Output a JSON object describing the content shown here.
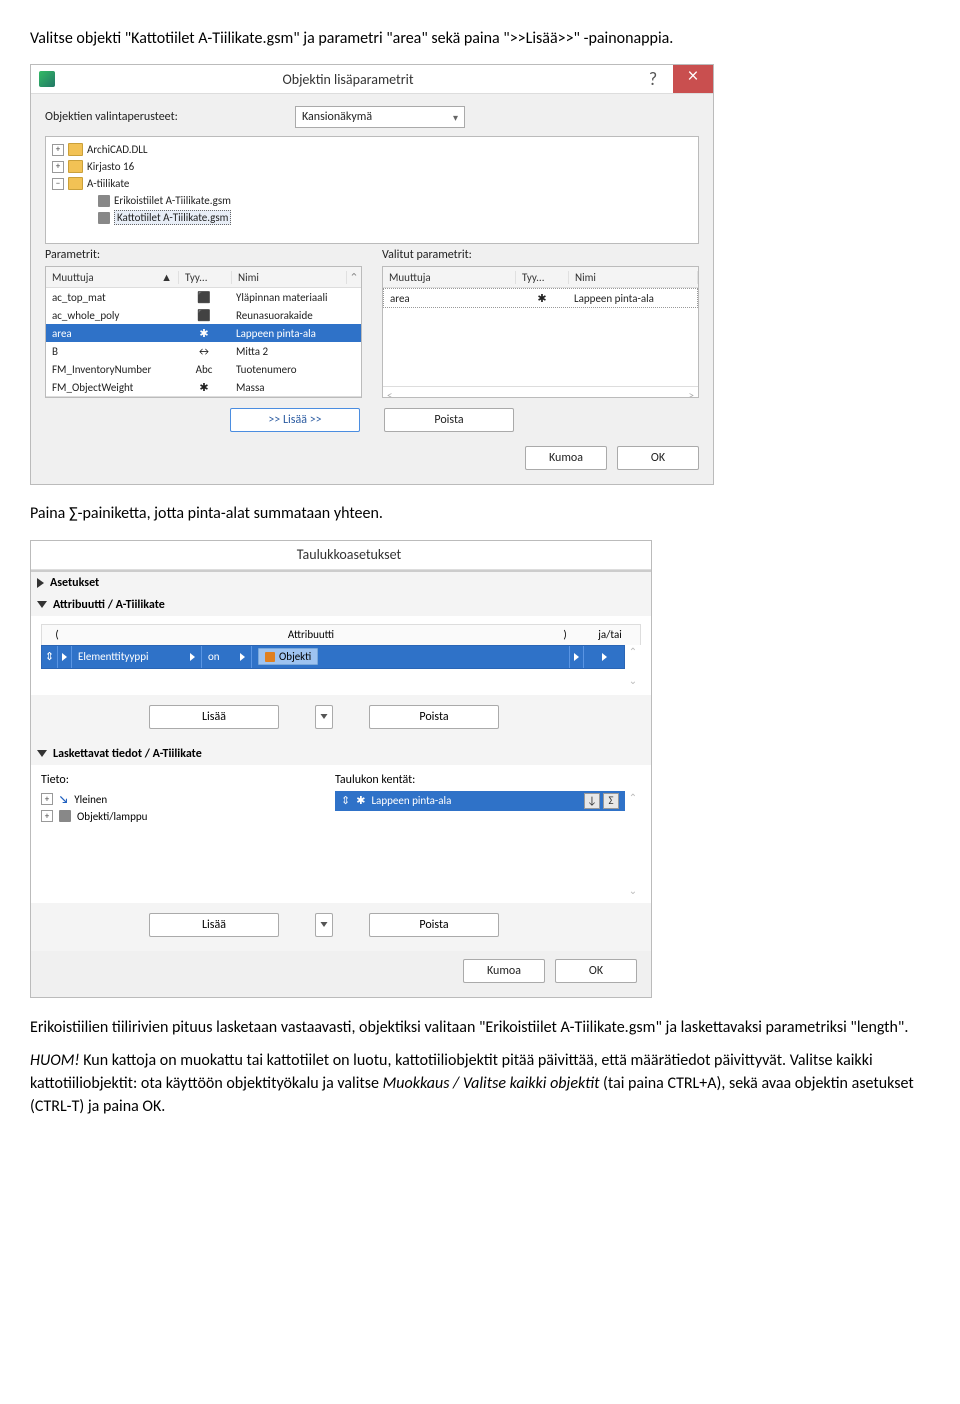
{
  "intro1": "Valitse objekti \"Kattotiilet A-Tiilikate.gsm\" ja parametri \"area\" sekä paina \">>Lisää>>\" -painonappia.",
  "intro2": "Paina ∑-painiketta, jotta pinta-alat summataan yhteen.",
  "dialog1": {
    "title": "Objektin lisäparametrit",
    "close": "×",
    "help": "?",
    "criteria_label": "Objektien valintaperusteet:",
    "criteria_value": "Kansionäkymä",
    "tree": {
      "nodes": [
        {
          "expander": "+",
          "icon": "folder",
          "label": "ArchiCAD.DLL"
        },
        {
          "expander": "+",
          "icon": "folder",
          "label": "Kirjasto 16"
        },
        {
          "expander": "−",
          "icon": "folder",
          "label": "A-tiilikate"
        },
        {
          "indent": 2,
          "icon": "object",
          "label": "Erikoistiilet A-Tiilikate.gsm"
        },
        {
          "indent": 2,
          "icon": "object",
          "label": "Kattotiilet A-Tiilikate.gsm",
          "selected": true
        }
      ]
    },
    "left_label": "Parametrit:",
    "right_label": "Valitut parametrit:",
    "headers": {
      "c1": "Muuttuja",
      "sort": "▲",
      "c2": "Tyy...",
      "c3": "Nimi"
    },
    "left_rows": [
      {
        "c1": "ac_top_mat",
        "c2": "⬛",
        "c3": "Yläpinnan materiaali"
      },
      {
        "c1": "ac_whole_poly",
        "c2": "⬛",
        "c3": "Reunasuorakaide"
      },
      {
        "c1": "area",
        "c2": "✱",
        "c3": "Lappeen pinta-ala",
        "sel": true
      },
      {
        "c1": "B",
        "c2": "↔",
        "c3": "Mitta 2"
      },
      {
        "c1": "FM_InventoryNumber",
        "c2": "Abc",
        "c3": "Tuotenumero"
      },
      {
        "c1": "FM_ObjectWeight",
        "c2": "✱",
        "c3": "Massa"
      }
    ],
    "right_rows": [
      {
        "c1": "area",
        "c2": "✱",
        "c3": "Lappeen pinta-ala"
      }
    ],
    "add": ">> Lisää >>",
    "remove": "Poista",
    "cancel": "Kumoa",
    "ok": "OK"
  },
  "dialog2": {
    "title": "Taulukkoasetukset",
    "section_settings": "Asetukset",
    "section_attr": "Attribuutti / A-Tiilikate",
    "attr_header": {
      "lp": "(",
      "mid": "Attribuutti",
      "rp": ")",
      "ja": "ja/tai"
    },
    "rule": {
      "handle": "⇕",
      "field": "Elementtityyppi",
      "op": "on",
      "value": "Objekti"
    },
    "add": "Lisää",
    "remove": "Poista",
    "section_lask": "Laskettavat tiedot / A-Tiilikate",
    "tieto_label": "Tieto:",
    "tieto_items": [
      {
        "expander": "+",
        "icon": "arrow",
        "label": "Yleinen"
      },
      {
        "expander": "+",
        "icon": "obj",
        "label": "Objekti/lamppu"
      }
    ],
    "tauluk_label": "Taulukon kentät:",
    "tauluk_row": {
      "icon": "✱",
      "label": "Lappeen pinta-ala",
      "sort": "↓",
      "sum": "Σ"
    },
    "cancel": "Kumoa",
    "ok": "OK"
  },
  "outro1": "Erikoistiilien tiilirivien pituus lasketaan vastaavasti, objektiksi valitaan \"Erikoistiilet A-Tiilikate.gsm\" ja laskettavaksi parametriksi \"length\".",
  "outro2_prefix": "HUOM! ",
  "outro2_body": "Kun kattoja on muokattu tai kattotiilet on luotu, kattotiiliobjektit pitää päivittää, että määrätiedot päivittyvät. Valitse kaikki kattotiiliobjektit: ota käyttöön objektityökalu ja valitse ",
  "outro2_ital": "Muokkaus / Valitse kaikki objektit",
  "outro2_tail": " (tai paina CTRL+A), sekä avaa objektin asetukset (CTRL-T) ja paina OK."
}
